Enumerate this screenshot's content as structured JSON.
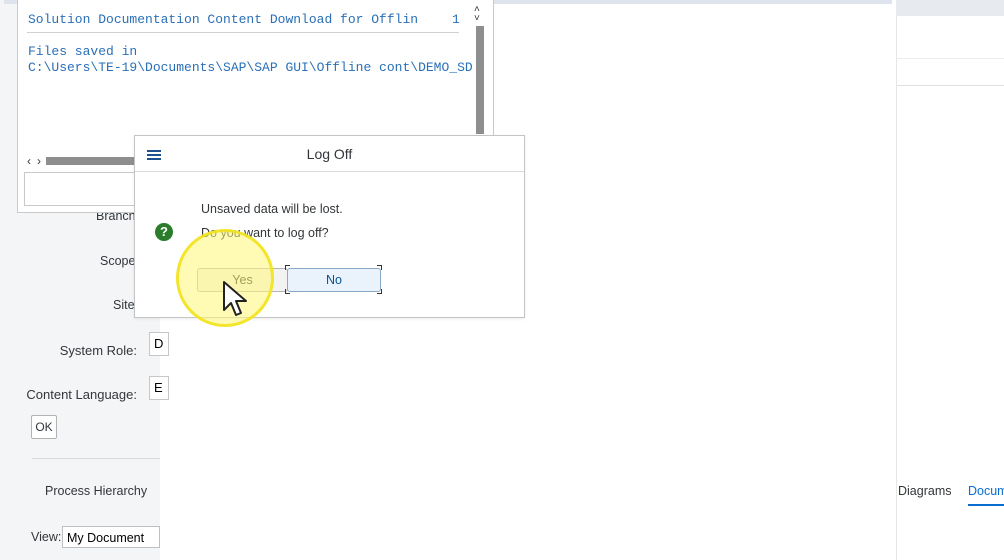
{
  "message_window": {
    "title": "Solution Documentation Content Download for Offlin",
    "count": "1",
    "line1": "Files saved in",
    "line2": "C:\\Users\\TE-19\\Documents\\SAP\\SAP GUI\\Offline cont\\DEMO_SD",
    "scroll_up": "˄",
    "scroll_down": "˅",
    "nav_left": "‹",
    "nav_right": "›"
  },
  "form": {
    "branch_label": "Branch",
    "scope_label": "Scope",
    "site_label": "Site",
    "system_role_label": "System Role:",
    "system_role_value": "D",
    "content_language_label": "Content Language:",
    "content_language_value": "E",
    "ok_label": "OK"
  },
  "tabs": {
    "process_hierarchy": "Process Hierarchy",
    "diagrams": "Diagrams",
    "documents": "Docum"
  },
  "view": {
    "label": "View:",
    "value": "My Document"
  },
  "dialog": {
    "title": "Log Off",
    "message1": "Unsaved data will be lost.",
    "message2": "Do you want to log off?",
    "yes_label": "Yes",
    "no_label": "No",
    "question_glyph": "?"
  },
  "icons": {
    "menu": "hamburger-menu-icon",
    "question": "question-icon",
    "cursor": "mouse-pointer-icon"
  },
  "colors": {
    "mono_text": "#2a6fb7",
    "question_green": "#2b7d2b",
    "highlight_yellow": "#f2e21e",
    "accent_blue": "#0a6ed1"
  }
}
